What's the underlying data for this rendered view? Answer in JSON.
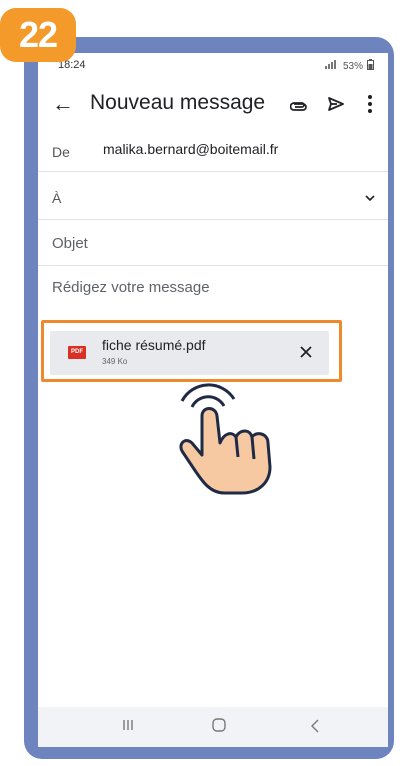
{
  "badge": {
    "number": "22",
    "color": "#f39a2a"
  },
  "status_bar": {
    "time": "18:24",
    "battery": "53%"
  },
  "app_bar": {
    "title": "Nouveau message",
    "icons": [
      "back-arrow-icon",
      "paperclip-icon",
      "send-icon",
      "more-vert-icon"
    ]
  },
  "fields": {
    "from_label": "De",
    "from_value": "malika.bernard@boitemail.fr",
    "to_label": "À",
    "subject_placeholder": "Objet",
    "body_placeholder": "Rédigez votre message"
  },
  "attachment": {
    "file_name": "fiche résumé.pdf",
    "file_size": "349 Ko",
    "icon_text": "PDF"
  },
  "colors": {
    "frame": "#6e84bf",
    "highlight": "#ee8a2d",
    "chip": "#e9eaee",
    "pdf_red": "#d93025"
  }
}
